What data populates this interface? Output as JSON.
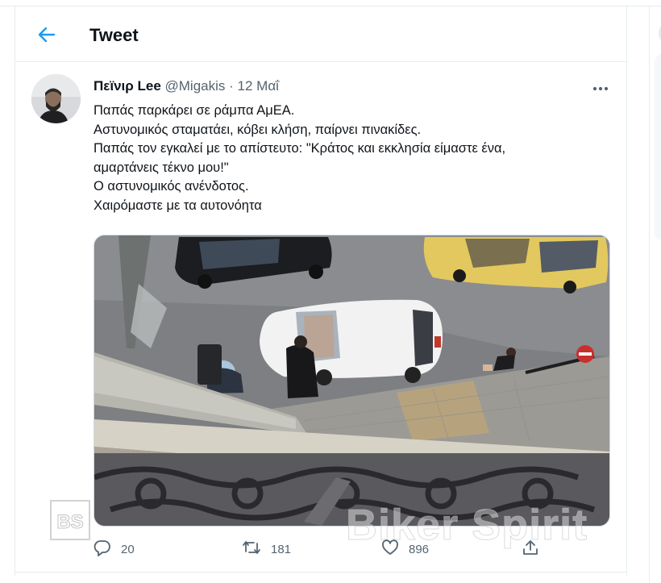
{
  "header": {
    "title": "Tweet"
  },
  "tweet": {
    "author_name": "Πεϊνιρ Lee",
    "handle": "@Migakis",
    "separator": "·",
    "date": "12 Μαΐ",
    "lines": [
      "Παπάς παρκάρει σε ράμπα ΑμΕΑ.",
      "Αστυνομικός σταματάει, κόβει κλήση, παίρνει πινακίδες.",
      "Παπάς τον εγκαλεί με το απίστευτο: \"Κράτος και εκκλησία είμαστε ένα,",
      "αμαρτάνεις τέκνο μου!\"",
      "Ο αστυνομικός ανένδοτος.",
      "Χαιρόμαστε με τα αυτονόητα"
    ],
    "counts": {
      "replies": "20",
      "retweets": "181",
      "likes": "896"
    }
  },
  "watermark": {
    "logo_text": "BS",
    "text": "Biker Spirit"
  },
  "colors": {
    "accent": "#1d9bf0",
    "muted": "#536471",
    "border": "#e6ecf0"
  },
  "icons": [
    "back-arrow-icon",
    "more-icon",
    "reply-icon",
    "retweet-icon",
    "like-icon",
    "share-icon"
  ]
}
